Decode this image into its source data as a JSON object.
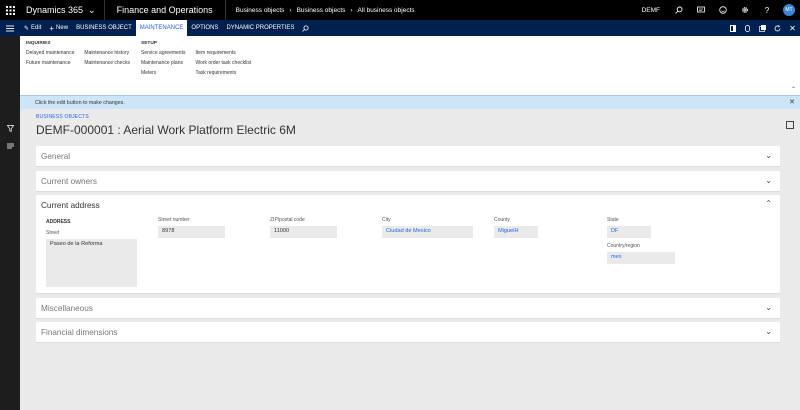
{
  "topbar": {
    "product": "Dynamics 365",
    "app": "Finance and Operations",
    "breadcrumbs": [
      "Business objects",
      "Business objects",
      "All business objects"
    ],
    "company": "DEMF",
    "user_initials": "MT"
  },
  "actionbar": {
    "edit": "Edit",
    "new": "New",
    "tabs": [
      "BUSINESS OBJECT",
      "MAINTENANCE",
      "OPTIONS",
      "DYNAMIC PROPERTIES"
    ]
  },
  "ribbon": {
    "inquiries": {
      "title": "INQUIRIES",
      "col1": [
        "Delayed maintenance",
        "Future maintenance"
      ],
      "col2": [
        "Maintenance history",
        "Maintenance checks"
      ]
    },
    "setup": {
      "title": "SETUP",
      "col1": [
        "Service agreements",
        "Maintenance plans",
        "Meters"
      ],
      "col2": [
        "Item requirements",
        "Work order task checklist",
        "Task requirements"
      ]
    }
  },
  "message": "Click the edit button to make changes.",
  "page": {
    "caption": "BUSINESS OBJECTS",
    "title": "DEMF-000001 : Aerial Work Platform Electric 6M"
  },
  "fasttabs": {
    "general": "General",
    "owners": "Current owners",
    "address": "Current address",
    "misc": "Miscellaneous",
    "financial": "Financial dimensions"
  },
  "address": {
    "heading": "ADDRESS",
    "street_label": "Street",
    "street": "Paseo de la Reforma",
    "street_number_label": "Street number",
    "street_number": "8978",
    "zip_label": "ZIP/postal code",
    "zip": "11000",
    "city_label": "City",
    "city": "Ciudad de Mexico",
    "county_label": "County",
    "county": "MiguelH",
    "state_label": "State",
    "state": "DF",
    "country_label": "Country/region",
    "country": "mex"
  },
  "colors": {
    "topbar": "#000000",
    "actionbar": "#002050",
    "accent": "#2266e3",
    "message": "#cde6f7"
  }
}
